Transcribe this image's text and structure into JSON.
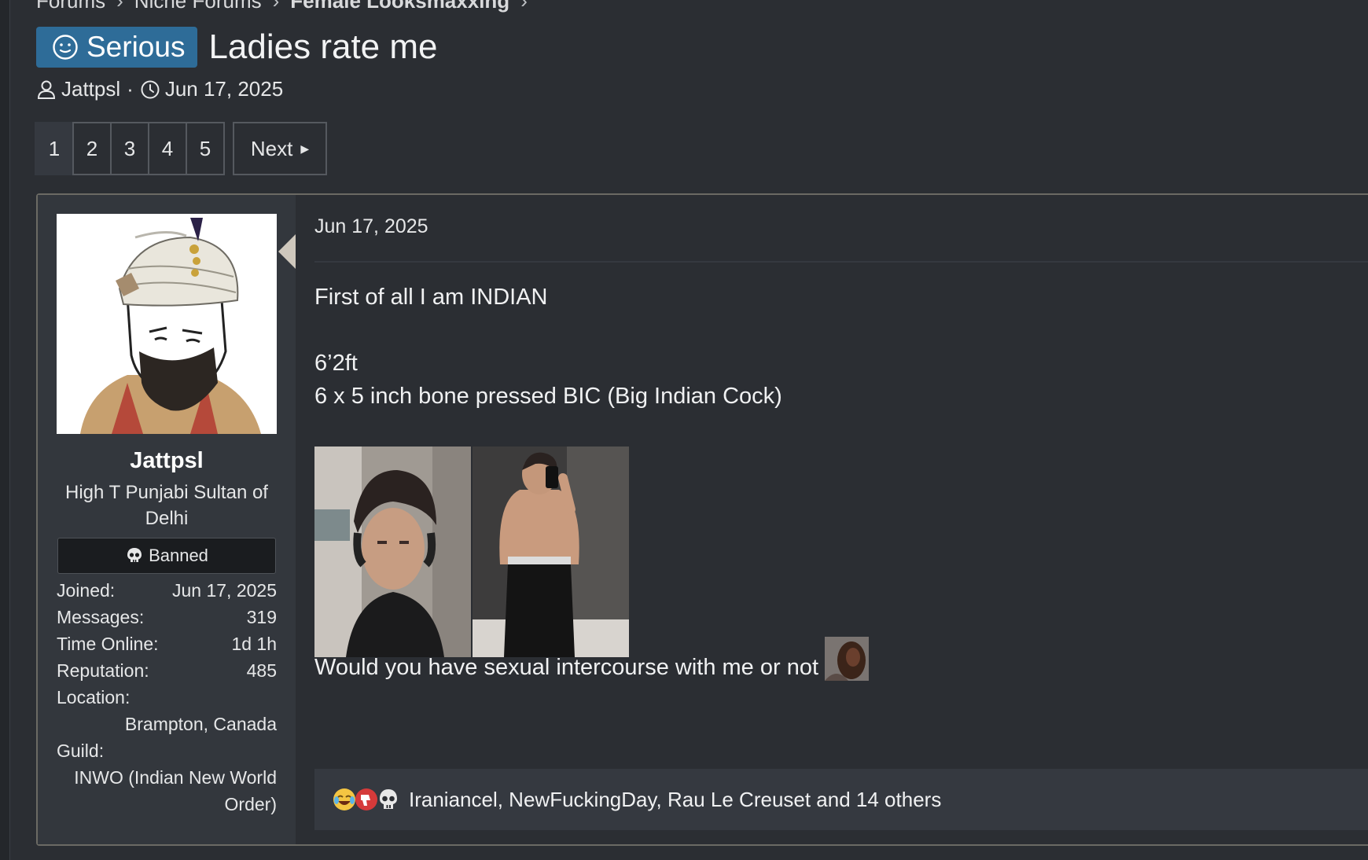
{
  "breadcrumb": [
    {
      "label": "Forums"
    },
    {
      "label": "Niche Forums"
    },
    {
      "label": "Female Looksmaxxing"
    }
  ],
  "thread": {
    "prefix": "Serious",
    "prefix_icon": "smile-icon",
    "prefix_color": "#2e6c98",
    "title": "Ladies rate me",
    "author": "Jattpsl",
    "separator": "·",
    "date": "Jun 17, 2025"
  },
  "pagination": {
    "pages": [
      "1",
      "2",
      "3",
      "4",
      "5"
    ],
    "current": "1",
    "next_label": "Next"
  },
  "post": {
    "user": {
      "name": "Jattpsl",
      "title": "High T Punjabi Sultan of Delhi",
      "banner": "Banned",
      "stats": {
        "joined_label": "Joined:",
        "joined": "Jun 17, 2025",
        "messages_label": "Messages:",
        "messages": "319",
        "online_label": "Time Online:",
        "online": "1d 1h",
        "reputation_label": "Reputation:",
        "reputation": "485",
        "location_label": "Location:",
        "location": "Brampton, Canada",
        "guild_label": "Guild:",
        "guild": "INWO (Indian New World Order)"
      }
    },
    "date": "Jun 17, 2025",
    "body": {
      "line1": "First of all I am INDIAN",
      "line2": "6’2ft",
      "line3": "6 x 5 inch bone pressed BIC (Big Indian Cock)",
      "line4": "Would you have sexual intercourse with me or not"
    },
    "reactions": {
      "icons": [
        "laughing-crying-emoji-icon",
        "thumbs-down-icon",
        "skull-icon"
      ],
      "text": "Iraniancel, NewFuckingDay, Rau Le Creuset and 14 others"
    }
  }
}
